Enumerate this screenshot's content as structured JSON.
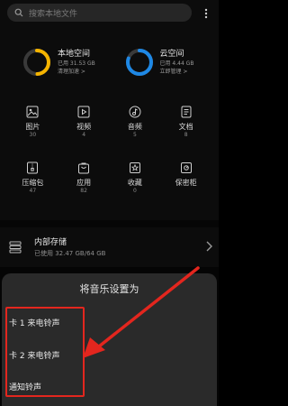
{
  "search": {
    "placeholder": "搜索本地文件"
  },
  "storage": [
    {
      "title": "本地空间",
      "sub": "已用 31.53 GB",
      "action": "清理加速 >",
      "used_fraction": 0.49,
      "ring_color": "#f5b400"
    },
    {
      "title": "云空间",
      "sub": "已用 4.44 GB",
      "action": "立即管理 >",
      "used_fraction": 0.8,
      "ring_color": "#1e88e5"
    }
  ],
  "categories": [
    {
      "label": "图片",
      "count": "30",
      "icon": "image-icon"
    },
    {
      "label": "视频",
      "count": "4",
      "icon": "video-icon"
    },
    {
      "label": "音频",
      "count": "5",
      "icon": "music-icon"
    },
    {
      "label": "文档",
      "count": "8",
      "icon": "document-icon"
    },
    {
      "label": "压缩包",
      "count": "47",
      "icon": "archive-icon"
    },
    {
      "label": "应用",
      "count": "82",
      "icon": "app-icon"
    },
    {
      "label": "收藏",
      "count": "0",
      "icon": "star-icon"
    },
    {
      "label": "保密柜",
      "count": "",
      "icon": "safe-icon"
    }
  ],
  "internal": {
    "title": "内部存储",
    "sub": "已使用 32.47 GB/64 GB"
  },
  "sheet": {
    "title": "将音乐设置为",
    "options": [
      "卡 1 来电铃声",
      "卡 2 来电铃声",
      "通知铃声"
    ]
  },
  "colors": {
    "annotation": "#e3261e",
    "background": "#0c0c0c",
    "sheet": "#2a2a2a"
  }
}
